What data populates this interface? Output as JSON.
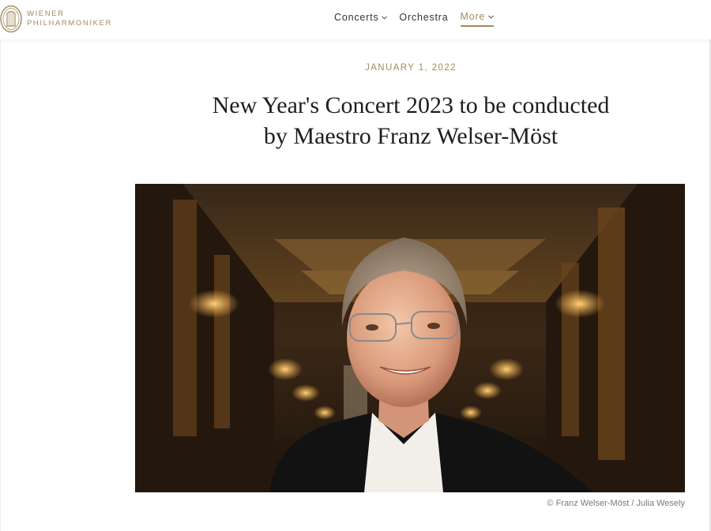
{
  "brand": {
    "line1": "WIENER",
    "line2": "PHILHARMONIKER",
    "logo_icon": "harp-crest-icon",
    "color": "#a48a5c"
  },
  "nav": {
    "items": [
      {
        "label": "Concerts",
        "has_dropdown": true,
        "active": false
      },
      {
        "label": "Orchestra",
        "has_dropdown": false,
        "active": false
      },
      {
        "label": "More",
        "has_dropdown": true,
        "active": true
      }
    ],
    "chevron_icon": "chevron-down-icon"
  },
  "article": {
    "date": "JANUARY 1, 2022",
    "title_line1": "New Year's Concert 2023 to be conducted",
    "title_line2": "by Maestro Franz Welser-Möst",
    "image_credit": "© Franz Welser-Möst / Julia Wesely"
  },
  "colors": {
    "accent": "#a48a5c",
    "text": "#1e1e1e"
  }
}
